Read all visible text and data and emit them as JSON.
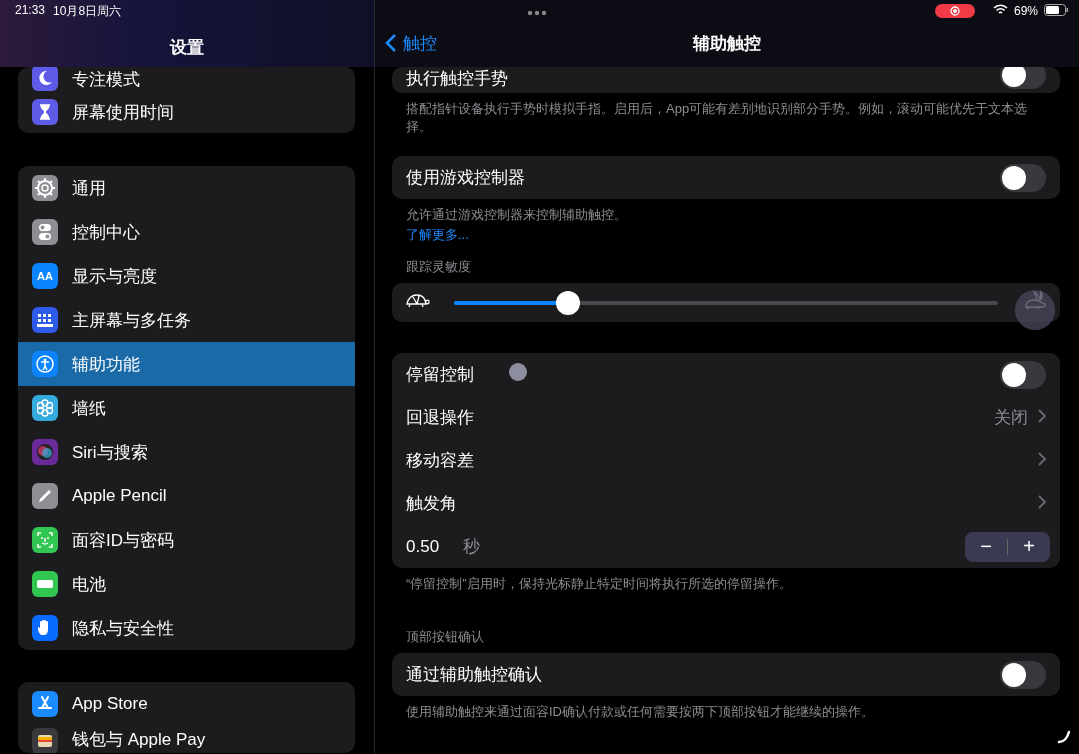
{
  "status_bar": {
    "time": "21:33",
    "date": "10月8日周六",
    "battery": "69%"
  },
  "sidebar": {
    "title": "设置",
    "groups": [
      {
        "items": [
          {
            "kind": "focus",
            "label": "专注模式",
            "color": "#5e5ce6",
            "selected": false
          },
          {
            "kind": "screen-time",
            "label": "屏幕使用时间",
            "color": "#5e5ce6",
            "selected": false
          }
        ]
      },
      {
        "items": [
          {
            "kind": "general",
            "label": "通用",
            "color": "#8e8e93",
            "selected": false
          },
          {
            "kind": "control-center",
            "label": "控制中心",
            "color": "#8e8e93",
            "selected": false
          },
          {
            "kind": "display",
            "label": "显示与亮度",
            "icon_text": "AA",
            "color": "#0a84ff",
            "selected": false
          },
          {
            "kind": "home-screen",
            "label": "主屏幕与多任务",
            "color": "#2f5bea",
            "selected": false
          },
          {
            "kind": "accessibility",
            "label": "辅助功能",
            "color": "#0a84ff",
            "selected": true
          },
          {
            "kind": "wallpaper",
            "label": "墙纸",
            "color": "#35aadc",
            "selected": false
          },
          {
            "kind": "siri",
            "label": "Siri与搜索",
            "color": "#6a2a9a",
            "selected": false
          },
          {
            "kind": "pencil",
            "label": "Apple Pencil",
            "color": "#8e8e93",
            "selected": false
          },
          {
            "kind": "face-id",
            "label": "面容ID与密码",
            "color": "#30c651",
            "selected": false
          },
          {
            "kind": "battery",
            "label": "电池",
            "color": "#30c651",
            "selected": false
          },
          {
            "kind": "privacy",
            "label": "隐私与安全性",
            "color": "#0a6cff",
            "selected": false
          }
        ]
      },
      {
        "items": [
          {
            "kind": "app-store",
            "label": "App Store",
            "color": "#1a8cff",
            "selected": false
          },
          {
            "kind": "wallet",
            "label": "钱包与 Apple Pay",
            "color": "#3a3a3c",
            "selected": false
          }
        ]
      }
    ]
  },
  "detail": {
    "back": "触控",
    "title": "辅助触控",
    "sections": [
      {
        "rows": [
          {
            "kind": "toggle",
            "label": "执行触控手势",
            "on": false
          }
        ],
        "footer": "搭配指针设备执行手势时模拟手指。启用后，App可能有差别地识别部分手势。例如，滚动可能优先于文本选择。"
      },
      {
        "rows": [
          {
            "kind": "toggle",
            "label": "使用游戏控制器",
            "on": false
          }
        ],
        "footer": "允许通过游戏控制器来控制辅助触控。",
        "link": "了解更多..."
      },
      {
        "header": "跟踪灵敏度",
        "rows": [
          {
            "kind": "slider",
            "level": 0.21
          }
        ]
      },
      {
        "rows": [
          {
            "kind": "toggle",
            "label": "停留控制",
            "on": false
          },
          {
            "kind": "link",
            "label": "回退操作",
            "value": "关闭"
          },
          {
            "kind": "link",
            "label": "移动容差"
          },
          {
            "kind": "link",
            "label": "触发角"
          },
          {
            "kind": "stepper",
            "value": "0.50",
            "unit": "秒",
            "minus": "−",
            "plus": "+"
          }
        ],
        "footer": "“停留控制”启用时，保持光标静止特定时间将执行所选的停留操作。"
      },
      {
        "header": "顶部按钮确认",
        "rows": [
          {
            "kind": "toggle",
            "label": "通过辅助触控确认",
            "on": false
          }
        ],
        "footer": "使用辅助触控来通过面容ID确认付款或任何需要按两下顶部按钮才能继续的操作。"
      }
    ]
  }
}
